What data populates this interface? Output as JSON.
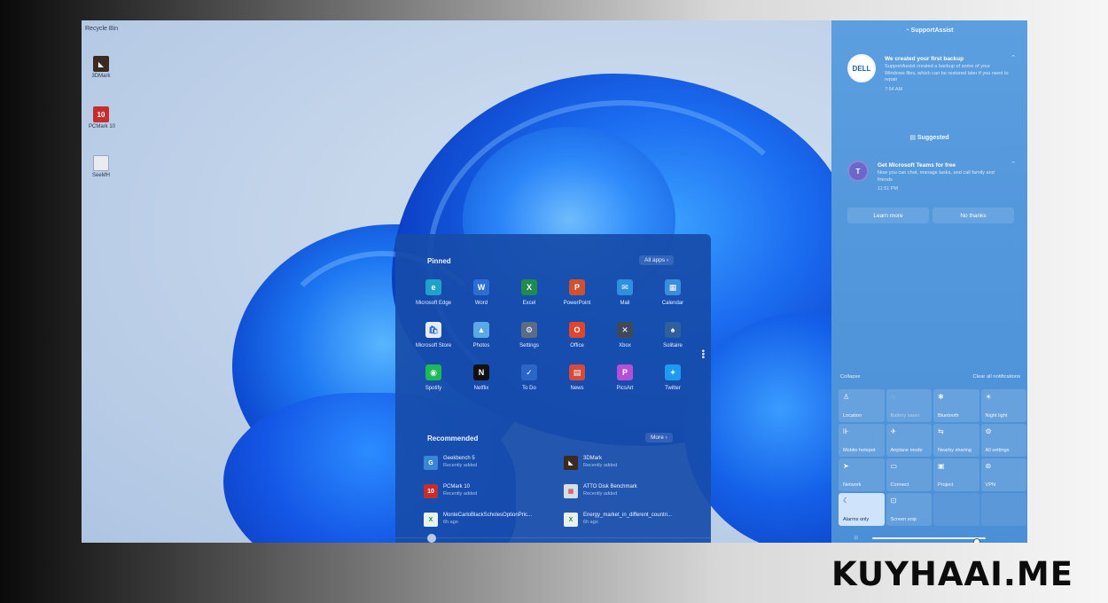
{
  "desktop": {
    "top_label": "Recycle Bin",
    "icons": [
      {
        "label": "3DMark",
        "icon": "3dmark-icon",
        "color": "#3a2a20",
        "glyph": "◣"
      },
      {
        "label": "PCMark 10",
        "icon": "pcmark-icon",
        "color": "#c62d2d",
        "glyph": "10"
      },
      {
        "label": "SeeMH",
        "icon": "document-icon",
        "color": "#e8ecf2",
        "glyph": ""
      }
    ]
  },
  "start_menu": {
    "pinned_title": "Pinned",
    "all_apps_label": "All apps",
    "pinned": [
      {
        "label": "Microsoft Edge",
        "icon": "edge-icon",
        "color": "#1fa1c9",
        "glyph": "e"
      },
      {
        "label": "Word",
        "icon": "word-icon",
        "color": "#2b6fd6",
        "glyph": "W"
      },
      {
        "label": "Excel",
        "icon": "excel-icon",
        "color": "#1f8b4c",
        "glyph": "X"
      },
      {
        "label": "PowerPoint",
        "icon": "powerpoint-icon",
        "color": "#d3502f",
        "glyph": "P"
      },
      {
        "label": "Mail",
        "icon": "mail-icon",
        "color": "#2f8fe0",
        "glyph": "✉"
      },
      {
        "label": "Calendar",
        "icon": "calendar-icon",
        "color": "#3b8be0",
        "glyph": "▦"
      },
      {
        "label": "Microsoft Store",
        "icon": "store-icon",
        "color": "#e6ecf5",
        "glyph": "🛍"
      },
      {
        "label": "Photos",
        "icon": "photos-icon",
        "color": "#5aa8e6",
        "glyph": "▲"
      },
      {
        "label": "Settings",
        "icon": "settings-icon",
        "color": "#5b6d86",
        "glyph": "⚙"
      },
      {
        "label": "Office",
        "icon": "office-icon",
        "color": "#e0462c",
        "glyph": "O"
      },
      {
        "label": "Xbox",
        "icon": "xbox-icon",
        "color": "#3e4a5a",
        "glyph": "✕"
      },
      {
        "label": "Solitaire",
        "icon": "solitaire-icon",
        "color": "#2f5f9f",
        "glyph": "♠"
      },
      {
        "label": "Spotify",
        "icon": "spotify-icon",
        "color": "#1db954",
        "glyph": "◉"
      },
      {
        "label": "Netflix",
        "icon": "netflix-icon",
        "color": "#111111",
        "glyph": "N"
      },
      {
        "label": "To Do",
        "icon": "todo-icon",
        "color": "#2a66c8",
        "glyph": "✓"
      },
      {
        "label": "News",
        "icon": "news-icon",
        "color": "#d64a3c",
        "glyph": "▤"
      },
      {
        "label": "PicsArt",
        "icon": "picsart-icon",
        "color": "#b54fd8",
        "glyph": "P"
      },
      {
        "label": "Twitter",
        "icon": "twitter-icon",
        "color": "#1d9bf0",
        "glyph": "✦"
      }
    ],
    "recommended_title": "Recommended",
    "more_label": "More",
    "recommended": [
      {
        "name": "Geekbench 5",
        "sub": "Recently added",
        "icon": "geekbench-icon",
        "color": "#3a85d6",
        "glyph": "G"
      },
      {
        "name": "3DMark",
        "sub": "Recently added",
        "icon": "3dmark-icon",
        "color": "#3a2a20",
        "glyph": "◣"
      },
      {
        "name": "PCMark 10",
        "sub": "Recently added",
        "icon": "pcmark-icon",
        "color": "#c62d2d",
        "glyph": "10"
      },
      {
        "name": "ATTO Disk Benchmark",
        "sub": "Recently added",
        "icon": "atto-icon",
        "color": "#d7dde6",
        "glyph": "▦"
      },
      {
        "name": "MonteCarloBlackScholesOptionPric...",
        "sub": "6h ago",
        "icon": "excel-file-icon",
        "color": "#e9f2ea",
        "glyph": "X"
      },
      {
        "name": "Energy_market_in_different_countri...",
        "sub": "6h ago",
        "icon": "excel-file-icon",
        "color": "#e9f2ea",
        "glyph": "X"
      }
    ]
  },
  "panel": {
    "supportassist_header": "SupportAssist",
    "backup": {
      "logo": "DELL",
      "title": "We created your first backup",
      "text": "SupportAssist created a backup of some of your Windows files, which can be restored later if you need to repair",
      "time": "7:54 AM"
    },
    "suggested_header": "Suggested",
    "teams": {
      "logo": "T",
      "title": "Get Microsoft Teams for free",
      "text": "Now you can chat, manage tasks, and call family and friends",
      "time": "11:51 PM"
    },
    "learn_more_label": "Learn more",
    "no_thanks_label": "No thanks",
    "collapse_label": "Collapse",
    "clear_all_label": "Clear all notifications",
    "quick_settings": [
      {
        "label": "Location",
        "icon": "location-icon",
        "glyph": "♙",
        "state": "off"
      },
      {
        "label": "Battery saver",
        "icon": "battery-saver-icon",
        "glyph": "◌",
        "state": "dim"
      },
      {
        "label": "Bluetooth",
        "icon": "bluetooth-icon",
        "glyph": "✱",
        "state": "off"
      },
      {
        "label": "Night light",
        "icon": "night-light-icon",
        "glyph": "☀",
        "state": "off"
      },
      {
        "label": "Mobile hotspot",
        "icon": "hotspot-icon",
        "glyph": "⊪",
        "state": "off"
      },
      {
        "label": "Airplane mode",
        "icon": "airplane-icon",
        "glyph": "✈",
        "state": "off"
      },
      {
        "label": "Nearby sharing",
        "icon": "nearby-sharing-icon",
        "glyph": "⇆",
        "state": "off"
      },
      {
        "label": "All settings",
        "icon": "settings-icon",
        "glyph": "⚙",
        "state": "off"
      },
      {
        "label": "Network",
        "icon": "network-icon",
        "glyph": "➤",
        "state": "off"
      },
      {
        "label": "Connect",
        "icon": "connect-icon",
        "glyph": "▭",
        "state": "off"
      },
      {
        "label": "Project",
        "icon": "project-icon",
        "glyph": "▣",
        "state": "off"
      },
      {
        "label": "VPN",
        "icon": "vpn-icon",
        "glyph": "⊛",
        "state": "off"
      },
      {
        "label": "Alarms only",
        "icon": "focus-assist-icon",
        "glyph": "☾",
        "state": "on"
      },
      {
        "label": "Screen snip",
        "icon": "screen-snip-icon",
        "glyph": "⊡",
        "state": "off"
      },
      {
        "label": "",
        "icon": "",
        "glyph": "",
        "state": "empty"
      },
      {
        "label": "",
        "icon": "",
        "glyph": "",
        "state": "empty"
      }
    ],
    "brightness_level": 0.92
  },
  "watermark": "KUYHAAI.ME",
  "colors": {
    "start_bg": "#174caa",
    "panel_bg": "#5397dc",
    "tile_on": "#cfe3fb"
  }
}
